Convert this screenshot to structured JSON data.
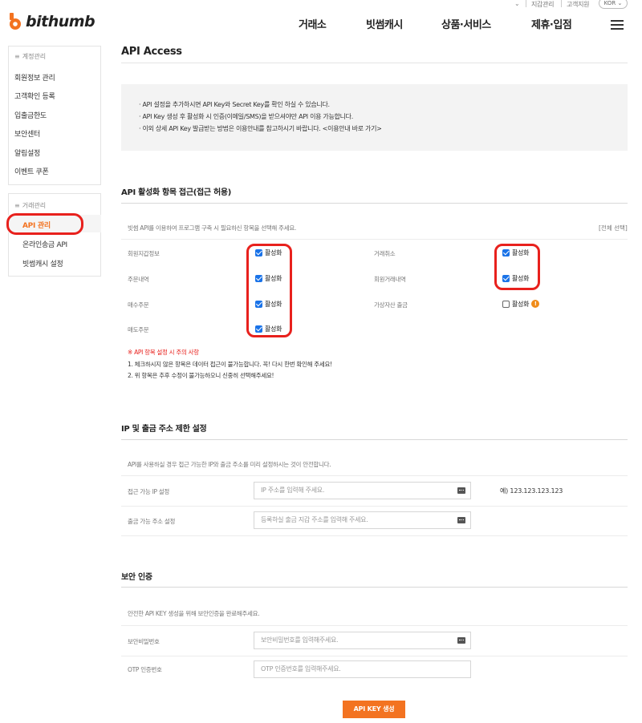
{
  "header": {
    "util_links": [
      "지갑관리",
      "고객지원"
    ],
    "language": "KOR",
    "logo_text": "bithumb",
    "nav": [
      "거래소",
      "빗썸캐시",
      "상품·서비스",
      "제휴·입점"
    ]
  },
  "sidebar": {
    "account_group": "계정관리",
    "account_items": [
      "회원정보 관리",
      "고객확인 등록",
      "입출금한도",
      "보안센터",
      "알림설정",
      "이벤트 쿠폰"
    ],
    "trade_group": "거래관리",
    "trade_items": [
      "API 관리",
      "온라인송금 API",
      "빗썸캐시 설정"
    ]
  },
  "main": {
    "title": "API Access",
    "notices": [
      "· API 설정을 추가하시면 API Key와 Secret Key를 확인 하실 수 있습니다.",
      "· API Key 생성 후 활성화 시 인증(이메일/SMS)을 받으셔야만 API 이용 가능합니다.",
      "· 이외 상세 API Key 발급받는 방법은 이용안내를 참고하시기 바랍니다. <이용안내 바로 가기>"
    ],
    "permissions": {
      "title": "API 활성화 항목 접근(접근 허용)",
      "description": "빗썸 API를 이용하여 프로그램 구축 시 필요하신 항목을 선택해 주세요.",
      "select_all": "[전체 선택]",
      "check_label": "활성화",
      "left": [
        {
          "label": "회원지갑정보",
          "checked": true
        },
        {
          "label": "주문내역",
          "checked": true
        },
        {
          "label": "매수주문",
          "checked": true
        },
        {
          "label": "매도주문",
          "checked": true
        }
      ],
      "right": [
        {
          "label": "거래취소",
          "checked": true
        },
        {
          "label": "회원거래내역",
          "checked": true
        },
        {
          "label": "가상자산 출금",
          "checked": false
        }
      ],
      "warning_title": "※ API 항목 설정 시 주의 사항",
      "warnings": [
        "1. 체크하시지 않은 항목은 데이터 접근이 불가능합니다. 꼭! 다시 한번 확인해 주세요!",
        "2. 위 항목은 추후 수정이 불가능하오니 신중히 선택해주세요!"
      ]
    },
    "ip_section": {
      "title": "IP 및 출금 주소 제한 설정",
      "description": "API를 사용하실 경우 접근 가능한 IP와 출금 주소를 미리 설정하시는 것이 안전합니다.",
      "ip_label": "접근 가능 IP 설정",
      "ip_placeholder": "IP 주소를 입력해 주세요.",
      "ip_example": "예) 123.123.123.123",
      "address_label": "출금 가능 주소 설정",
      "address_placeholder": "등록하실 출금 지갑 주소를 입력해 주세요."
    },
    "security": {
      "title": "보안 인증",
      "description": "안전한 API KEY 생성을 위해 보안인증을 완료해주세요.",
      "password_label": "보안비밀번호",
      "password_placeholder": "보안비밀번호를 입력해주세요.",
      "otp_label": "OTP 인증번호",
      "otp_placeholder": "OTP 인증번호를 입력해주세요."
    },
    "submit_label": "API KEY 생성"
  },
  "colors": {
    "accent": "#f37321",
    "highlight_red": "#e8211d",
    "checkbox_blue": "#1a73e8"
  }
}
